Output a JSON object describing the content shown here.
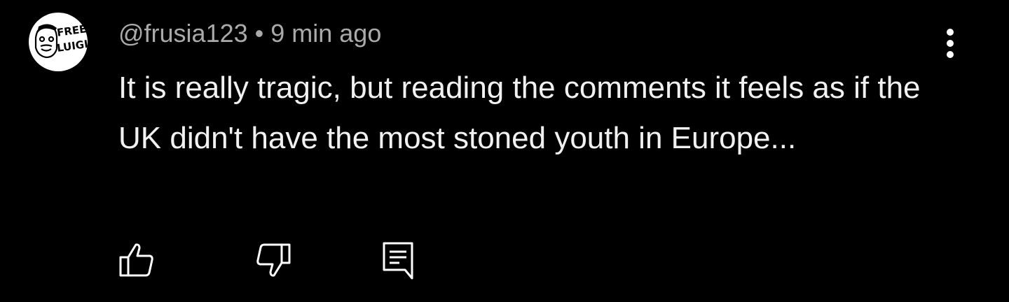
{
  "comment": {
    "author": "@frusia123",
    "separator": "•",
    "timestamp": "9 min ago",
    "text": "It is really tragic, but reading the comments it feels as if the UK didn't have the most stoned youth in Europe...",
    "avatar": {
      "line1": "FREE",
      "line2": "LUIGI"
    }
  },
  "icons": {
    "more": "more-vert-icon",
    "like": "thumbs-up-icon",
    "dislike": "thumbs-down-icon",
    "reply": "comment-reply-icon"
  },
  "colors": {
    "background": "#000000",
    "text": "#f1f1f1",
    "meta": "#aaaaaa",
    "icon": "#ffffff"
  }
}
